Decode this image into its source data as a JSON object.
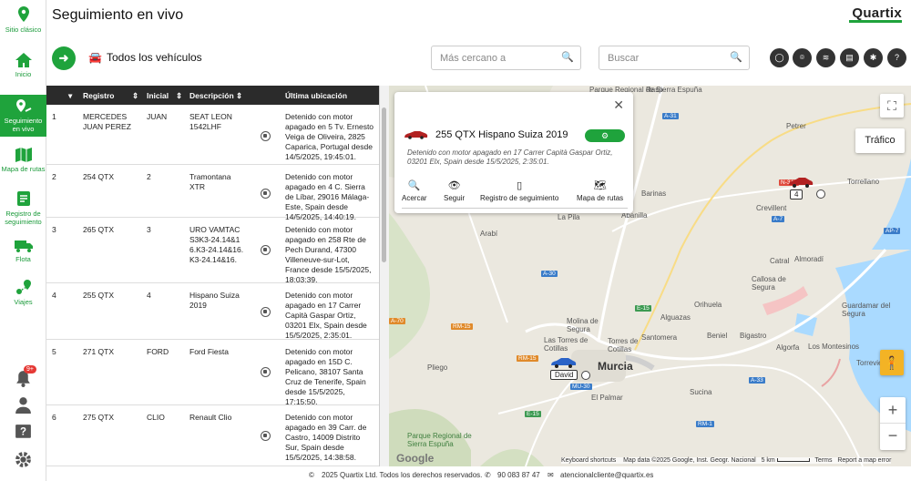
{
  "sidebar": {
    "items": [
      {
        "label": "Sitio clásico",
        "icon": "map-pin-icon"
      },
      {
        "label": "Inicio",
        "icon": "home-icon"
      },
      {
        "label": "Seguimiento en vivo",
        "icon": "live-tracking-icon"
      },
      {
        "label": "Mapa de rutas",
        "icon": "route-map-icon"
      },
      {
        "label": "Registro de seguimiento",
        "icon": "tracking-log-icon"
      },
      {
        "label": "Flota",
        "icon": "truck-icon"
      },
      {
        "label": "Viajes",
        "icon": "trips-icon"
      }
    ],
    "notification_badge": "9+"
  },
  "header": {
    "title": "Seguimiento en vivo",
    "logo": "Quartix",
    "vehicle_filter": "Todos los vehículos",
    "nearest_placeholder": "Más cercano a",
    "search_placeholder": "Buscar"
  },
  "table": {
    "columns": [
      "Registro",
      "Inicial",
      "Descripción",
      "Última ubicación"
    ],
    "rows": [
      {
        "n": "1",
        "registro": "MERCEDES JUAN PEREZ",
        "inicial": "JUAN",
        "descripcion": "SEAT LEON 1542LHF",
        "ubicacion": "Detenido con motor apagado en 5 Tv. Ernesto Veiga de Oliveira, 2825 Caparica, Portugal desde 14/5/2025, 19:45:01."
      },
      {
        "n": "2",
        "registro": "254 QTX",
        "inicial": "2",
        "descripcion": "Tramontana XTR",
        "ubicacion": "Detenido con motor apagado en 4 C. Sierra de Líbar, 29016 Málaga-Este, Spain desde 14/5/2025, 14:40:19."
      },
      {
        "n": "3",
        "registro": "265 QTX",
        "inicial": "3",
        "descripcion": "URO VAMTAC S3K3-24.14&16.K3-24.14&16.K3-24.14&16.",
        "ubicacion": "Detenido con motor apagado en 258 Rte de Pech Durand, 47300 Villeneuve-sur-Lot, France desde 15/5/2025, 18:03:39."
      },
      {
        "n": "4",
        "registro": "255 QTX",
        "inicial": "4",
        "descripcion": "Hispano Suiza 2019",
        "ubicacion": "Detenido con motor apagado en 17 Carrer Capità Gaspar Ortiz, 03201 Elx, Spain desde 15/5/2025, 2:35:01."
      },
      {
        "n": "5",
        "registro": "271 QTX",
        "inicial": "FORD",
        "descripcion": "Ford Fiesta",
        "ubicacion": "Detenido con motor apagado en 15D C. Pelicano, 38107 Santa Cruz de Tenerife, Spain desde 15/5/2025, 17:15:50."
      },
      {
        "n": "6",
        "registro": "275 QTX",
        "inicial": "CLIO",
        "descripcion": "Renault Clio",
        "ubicacion": "Detenido con motor apagado en 39 Carr. de Castro, 14009 Distrito Sur, Spain desde 15/5/2025, 14:38:58."
      }
    ]
  },
  "popup": {
    "title": "255 QTX Hispano Suiza 2019",
    "status": "Detenido con motor apagado en 17 Carrer Capità Gaspar Ortiz, 03201 Elx, Spain desde 15/5/2025, 2:35:01.",
    "actions": [
      "Acercar",
      "Seguir",
      "Registro de seguimiento",
      "Mapa de rutas"
    ]
  },
  "map": {
    "traffic_button": "Tráfico",
    "places": [
      "Rasp",
      "Petrer",
      "Torrellano",
      "Crevillent",
      "Barinas",
      "Abanilla",
      "Arabí",
      "Catral",
      "Callosa de Segura",
      "Almoradí",
      "Orihuela",
      "Molina de Segura",
      "Las Torres de Cotillas",
      "Alguazas",
      "Torres de Cotillas",
      "Pliego",
      "Santomera",
      "Beniel",
      "Guardamar del Segura",
      "Torrevieja",
      "El Palmar",
      "Bigastro",
      "Parque Regional de Sierra Espuña",
      "Parque",
      "La Pila",
      "Sucina",
      "Los Montesinos",
      "Algorfa"
    ],
    "city": "Murcia",
    "roads": [
      "A-31",
      "N-340",
      "A-7",
      "AP-7",
      "A-30",
      "E-15",
      "RM-15",
      "A-33",
      "MU-30",
      "RM-1",
      "A-70"
    ],
    "vehicle_labels": [
      "4",
      "David"
    ],
    "attribution": [
      "Keyboard shortcuts",
      "Map data ©2025 Google, Inst. Geogr. Nacional",
      "5 km",
      "Terms",
      "Report a map error"
    ],
    "google": "Google"
  },
  "footer": {
    "copyright": "2025 Quartix Ltd. Todos los derechos reservados.",
    "phone": "90 083 87 47",
    "email": "atencionalcliente@quartix.es"
  }
}
